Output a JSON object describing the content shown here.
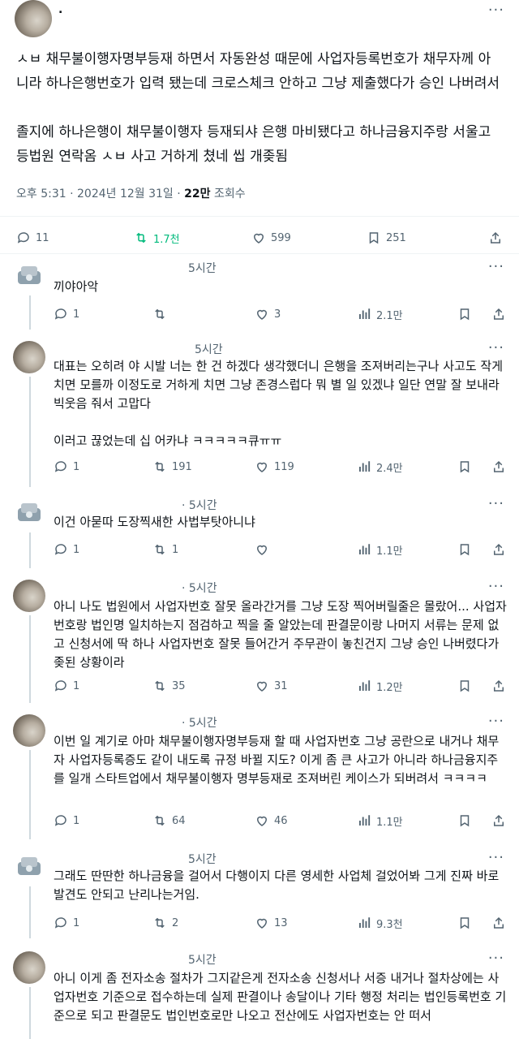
{
  "main_tweet": {
    "author": ".",
    "body": "ㅅㅂ 채무불이행자명부등재 하면서 자동완성 때문에 사업자등록번호가 채무자께 아니라 하나은행번호가 입력 됐는데 크로스체크 안하고 그냥 제출했다가 승인 나버려서\n\n졸지에 하나은행이 채무불이행자 등재되샤 은행 마비됐다고 하나금융지주랑 서울고등법원 연락옴 ㅅㅂ 사고 거하게 쳤네 씹 개좆됨",
    "time": "오후 5:31 · 2024년 12월 31일 · ",
    "views_count": "22만",
    "views_label": " 조회수",
    "replies": "11",
    "retweets": "1.7천",
    "likes": "599",
    "bookmarks": "251"
  },
  "replies": [
    {
      "time": "5시간",
      "body": "끼야아악",
      "reply": "1",
      "rt": "",
      "like": "3",
      "views": "2.1만"
    },
    {
      "time": "5시간",
      "body": "대표는 오히려 야 시발 너는 한 건 하겠다 생각했더니 은행을 조져버리는구나 사고도 작게 치면 모를까 이정도로 거하게 치면 그냥 존경스럽다 뭐 별 일 있겠냐 일단 연말 잘 보내라 빅웃음 줘서 고맙다\n\n이러고 끊었는데 십 어카냐 ㅋㅋㅋㅋㅋ큐ㅠㅠ",
      "reply": "1",
      "rt": "191",
      "like": "119",
      "views": "2.4만"
    },
    {
      "time": "· 5시간",
      "body": "이건 아묻따 도장찍새한 사법부탓아니냐",
      "reply": "1",
      "rt": "1",
      "like": "",
      "views": "1.1만"
    },
    {
      "time": "· 5시간",
      "body": "아니 나도 법원에서 사업자번호 잘못 올라간거를 그냥 도장 찍어버릴줄은 몰랐어... 사업자번호랑 법인명 일치하는지 점검하고 찍을 줄 알았는데 판결문이랑 나머지 서류는 문제 없고 신청서에 딱 하나 사업자번호 잘못 들어간거 주무관이 놓친건지 그냥 승인 나버렸다가 좆된 상황이라",
      "reply": "1",
      "rt": "35",
      "like": "31",
      "views": "1.2만"
    },
    {
      "time": "· 5시간",
      "body": "이번 일 계기로 아마 채무불이행자명부등재 할 때 사업자번호 그냥 공란으로 내거나 채무자 사업자등록증도 같이 내도록 규정 바뀔 지도? 이게 좀 큰 사고가 아니라 하나금융지주를 일개 스타트업에서 채무불이행자 명부등재로 조져버린 케이스가 되버려서 ㅋㅋㅋㅋ",
      "reply": "1",
      "rt": "64",
      "like": "46",
      "views": "1.1만"
    },
    {
      "time": "5시간",
      "body": "그래도 딴딴한 하나금융을 걸어서 다행이지 다른 영세한 사업체 걸었어봐 그게 진짜 바로 발견도 안되고 난리나는거임.",
      "reply": "1",
      "rt": "2",
      "like": "13",
      "views": "9.3천"
    },
    {
      "time": "5시간",
      "body": "아니 이게 좀 전자소송 절차가 그지같은게 전자소송 신청서나 서증 내거나 절차상에는 사업자번호 기준으로 접수하는데 실제 판결이나 송달이나 기타 행정 처리는 법인등록번호 기준으로 되고 판결문도 법인번호로만 나오고 전산에도 사업자번호는 안 떠서",
      "reply": "",
      "rt": "",
      "like": "",
      "views": ""
    }
  ],
  "colors": {
    "retweet_active": "#00ba7c",
    "muted": "#536471",
    "text": "#0f1419"
  }
}
